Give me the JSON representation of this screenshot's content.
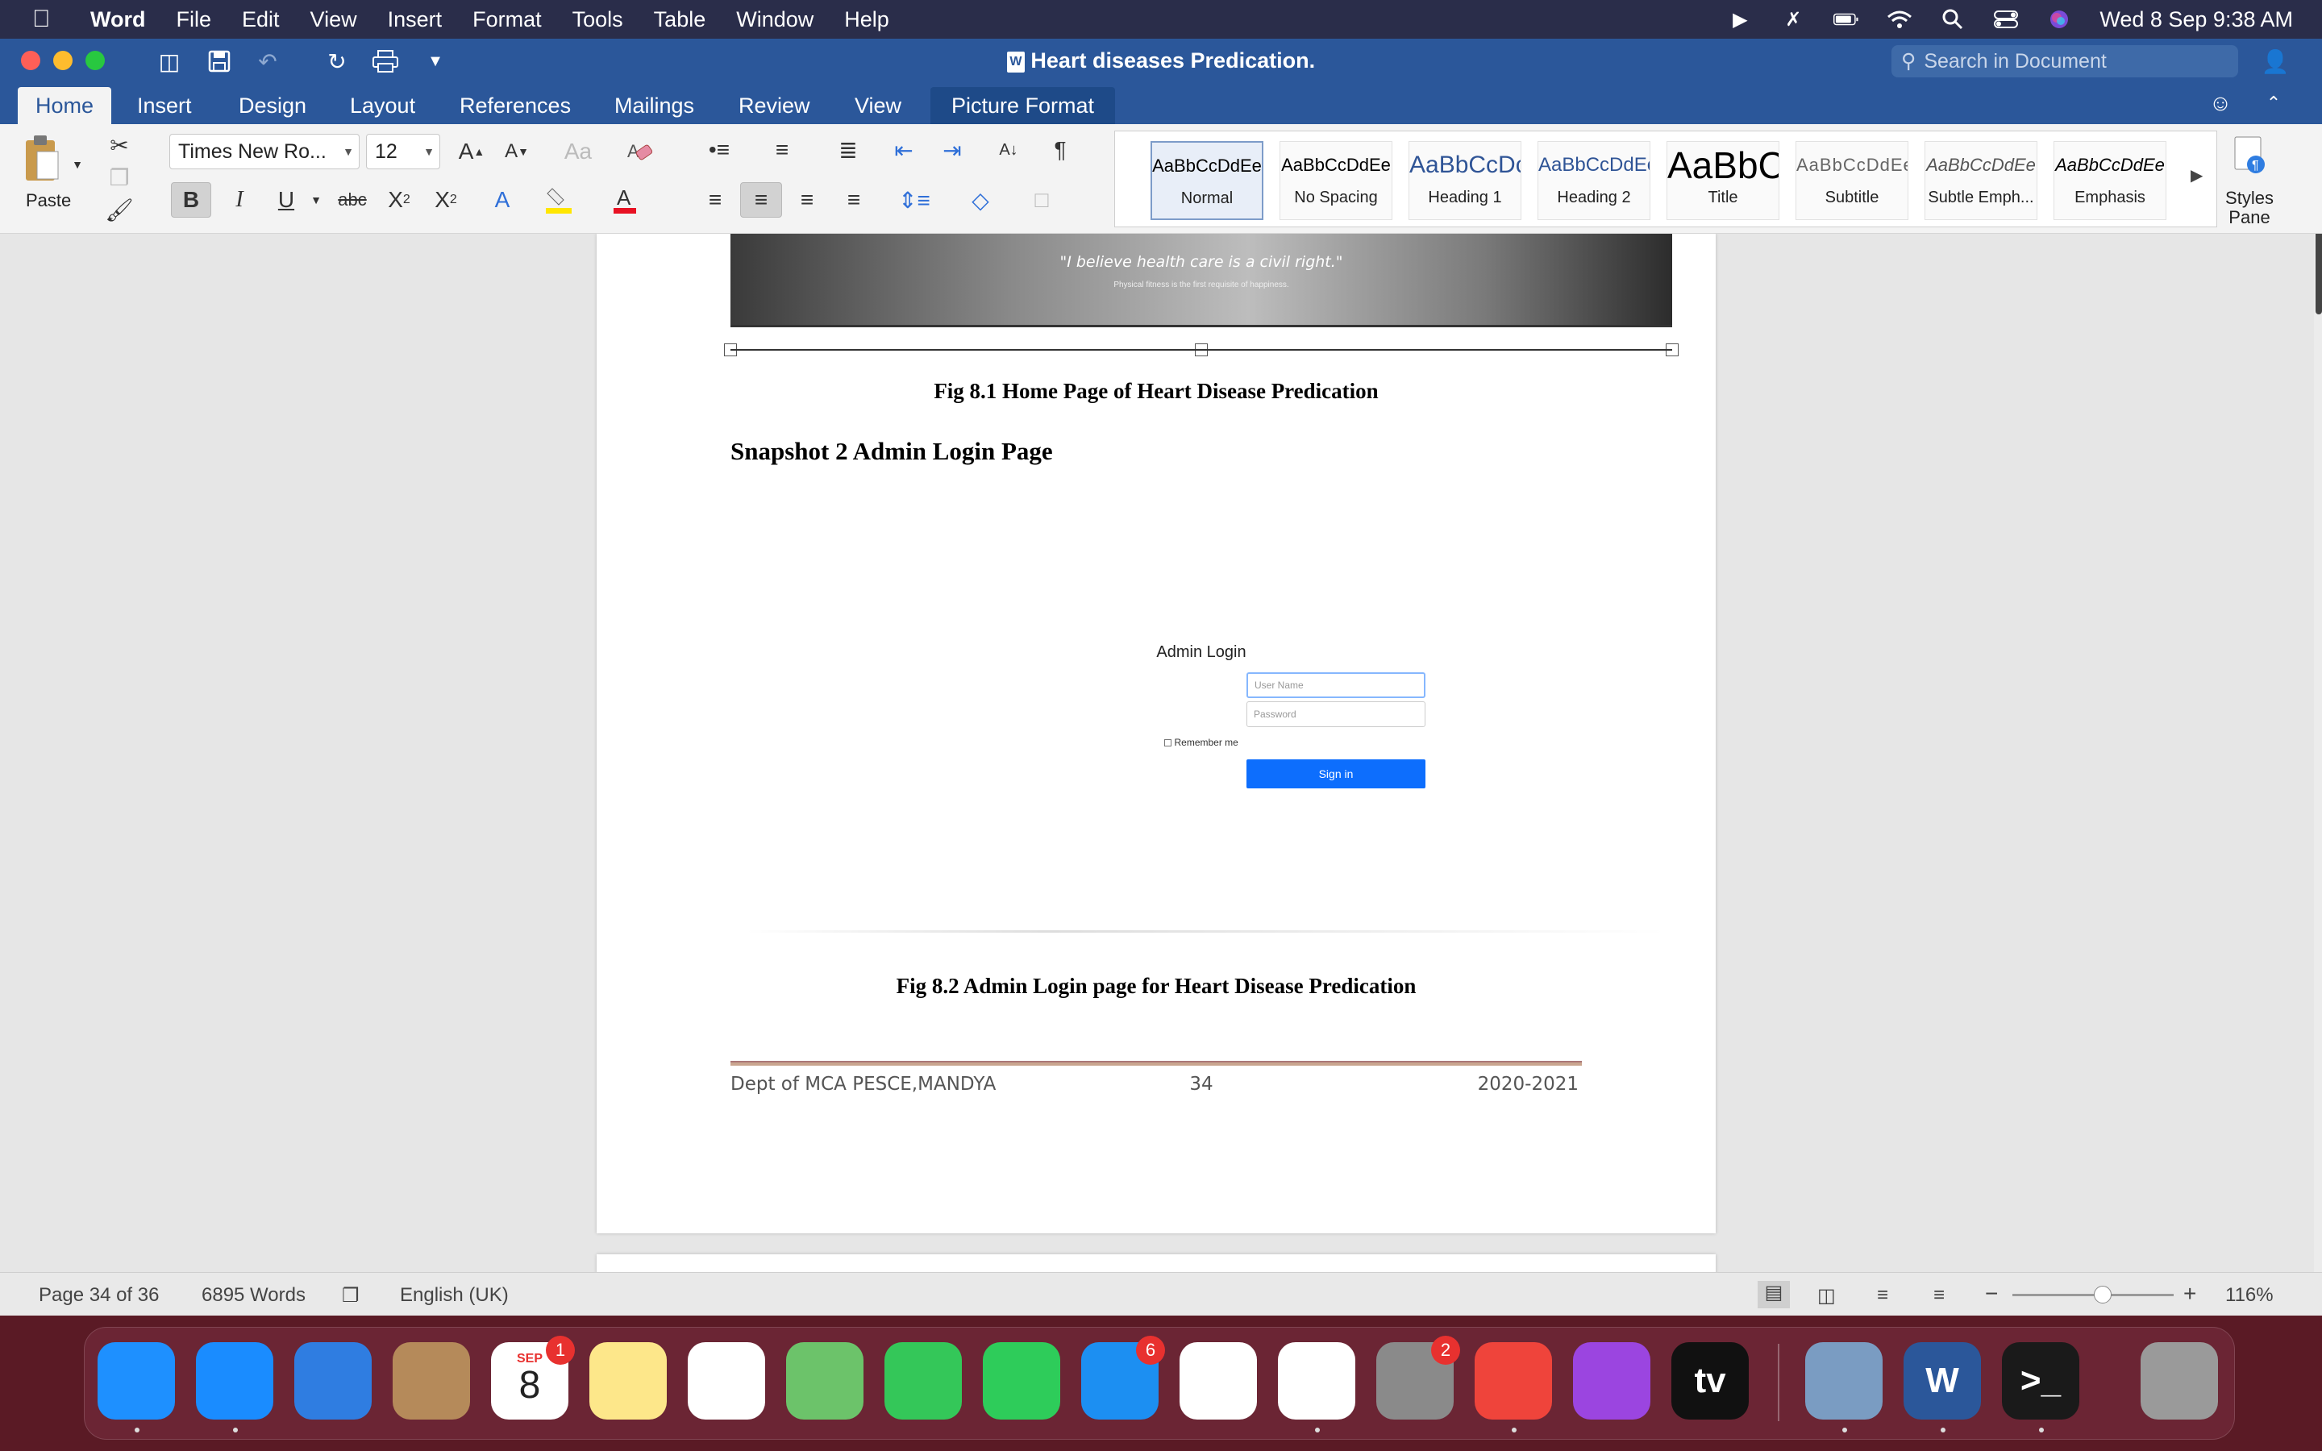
{
  "menubar": {
    "app_name": "Word",
    "items": [
      "File",
      "Edit",
      "View",
      "Insert",
      "Format",
      "Tools",
      "Table",
      "Window",
      "Help"
    ],
    "datetime": "Wed 8 Sep  9:38 AM"
  },
  "window": {
    "title": "Heart diseases Predication.",
    "search_placeholder": "Search in Document"
  },
  "tabs": [
    "Home",
    "Insert",
    "Design",
    "Layout",
    "References",
    "Mailings",
    "Review",
    "View",
    "Picture Format"
  ],
  "ribbon": {
    "paste_label": "Paste",
    "font_name": "Times New Ro...",
    "font_size": "12",
    "styles": [
      {
        "sample": "AaBbCcDdEe",
        "name": "Normal"
      },
      {
        "sample": "AaBbCcDdEe",
        "name": "No Spacing"
      },
      {
        "sample": "AaBbCcDc",
        "name": "Heading 1"
      },
      {
        "sample": "AaBbCcDdEe",
        "name": "Heading 2"
      },
      {
        "sample": "AaBbC",
        "name": "Title"
      },
      {
        "sample": "AaBbCcDdEe",
        "name": "Subtitle"
      },
      {
        "sample": "AaBbCcDdEe",
        "name": "Subtle Emph..."
      },
      {
        "sample": "AaBbCcDdEe",
        "name": "Emphasis"
      }
    ],
    "styles_pane_label": "Styles Pane",
    "colors": {
      "accent": "#2b579a",
      "font_color_bar": "#e81123",
      "highlight_bar": "#ffe600"
    }
  },
  "document": {
    "hero_quote": "\"I believe health care is a civil right.\"",
    "hero_sub": "Physical fitness is the first requisite of happiness.",
    "fig1_caption": "Fig 8.1 Home Page of Heart Disease Predication",
    "snapshot_heading": "Snapshot 2 Admin Login Page",
    "login": {
      "title": "Admin Login",
      "username_placeholder": "User Name",
      "password_placeholder": "Password",
      "remember": "Remember me",
      "signin": "Sign in",
      "signin_color": "#0d6efd"
    },
    "fig2_caption": "Fig 8.2 Admin Login page for Heart Disease Predication",
    "footer": {
      "left": "Dept of MCA PESCE,MANDYA",
      "center": "34",
      "right": "2020-2021"
    }
  },
  "statusbar": {
    "page": "Page 34 of 36",
    "words": "6895 Words",
    "language": "English (UK)",
    "zoom": "116%",
    "zoom_level": 0.56
  },
  "dock": {
    "apps": [
      {
        "name": "Finder",
        "icon": "finder-icon",
        "color": "#1e90ff"
      },
      {
        "name": "Safari",
        "icon": "safari-icon",
        "color": "#1a8cff"
      },
      {
        "name": "Mail",
        "icon": "mail-icon",
        "color": "#2f7de1"
      },
      {
        "name": "Contacts",
        "icon": "contacts-icon",
        "color": "#b58a5a"
      },
      {
        "name": "Calendar",
        "icon": "calendar-icon",
        "color": "#ffffff",
        "month": "SEP",
        "day": "8",
        "badge": "1"
      },
      {
        "name": "Notes",
        "icon": "notes-icon",
        "color": "#fde78a"
      },
      {
        "name": "Reminders",
        "icon": "reminders-icon",
        "color": "#ffffff"
      },
      {
        "name": "Maps",
        "icon": "maps-icon",
        "color": "#6cc36a"
      },
      {
        "name": "Messages",
        "icon": "messages-icon",
        "color": "#34c759"
      },
      {
        "name": "FaceTime",
        "icon": "facetime-icon",
        "color": "#2ecc5a"
      },
      {
        "name": "App Store",
        "icon": "app-store-icon",
        "color": "#1c8ff2",
        "badge": "6"
      },
      {
        "name": "Photos",
        "icon": "photos-icon",
        "color": "#ffffff"
      },
      {
        "name": "Chrome",
        "icon": "chrome-icon",
        "color": "#ffffff"
      },
      {
        "name": "System Preferences",
        "icon": "system-preferences-icon",
        "color": "#8a8a8a",
        "badge": "2"
      },
      {
        "name": "AnyDesk",
        "icon": "anydesk-icon",
        "color": "#ef443b"
      },
      {
        "name": "Podcasts",
        "icon": "podcasts-icon",
        "color": "#9b45e0"
      },
      {
        "name": "Apple TV",
        "icon": "apple-tv-icon",
        "color": "#111111",
        "label": "tv"
      },
      {
        "name": "Preview",
        "icon": "preview-icon",
        "color": "#7a9cc2"
      },
      {
        "name": "Word",
        "icon": "word-icon",
        "color": "#2b579a",
        "label": "W"
      },
      {
        "name": "Terminal",
        "icon": "terminal-icon",
        "color": "#1a1a1a",
        "label": ">_"
      },
      {
        "name": "Trash",
        "icon": "trash-icon",
        "color": "#9a9a9a"
      }
    ]
  }
}
